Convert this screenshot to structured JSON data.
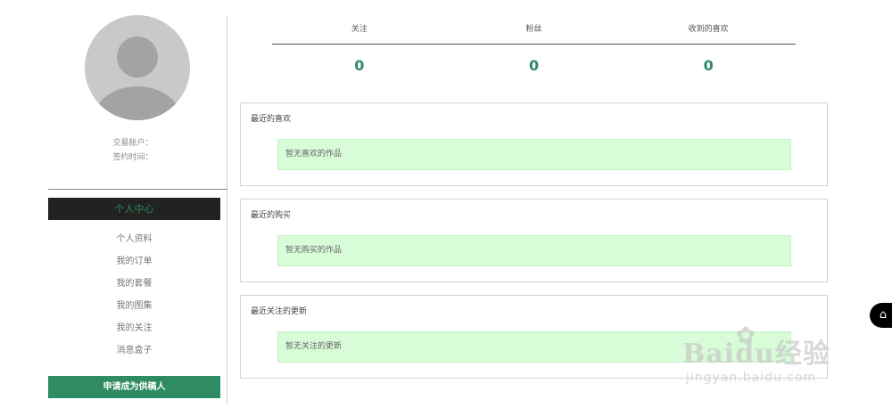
{
  "profile": {
    "account_label": "交易账户：",
    "sign_time_label": "签约时间："
  },
  "menu": {
    "header": "个人中心",
    "items": [
      "个人资料",
      "我的订单",
      "我的套餐",
      "我的图集",
      "我的关注",
      "消息盒子"
    ]
  },
  "apply_button": "申请成为供稿人",
  "stats": {
    "labels": [
      "关注",
      "粉丝",
      "收到的喜欢"
    ],
    "values": [
      "0",
      "0",
      "0"
    ]
  },
  "panels": [
    {
      "title": "最近的喜欢",
      "empty": "暂无喜欢的作品"
    },
    {
      "title": "最近的购买",
      "empty": "暂无购买的作品"
    },
    {
      "title": "最近关注的更新",
      "empty": "暂无关注的更新"
    }
  ],
  "watermark": {
    "main": "Baidu经验",
    "sub": "jingyan.baidu.com"
  },
  "icons": {
    "float": "house-icon"
  },
  "colors": {
    "accent": "#2e8b62",
    "empty_bg": "#d8fbd8",
    "menu_head_bg": "#222222"
  }
}
